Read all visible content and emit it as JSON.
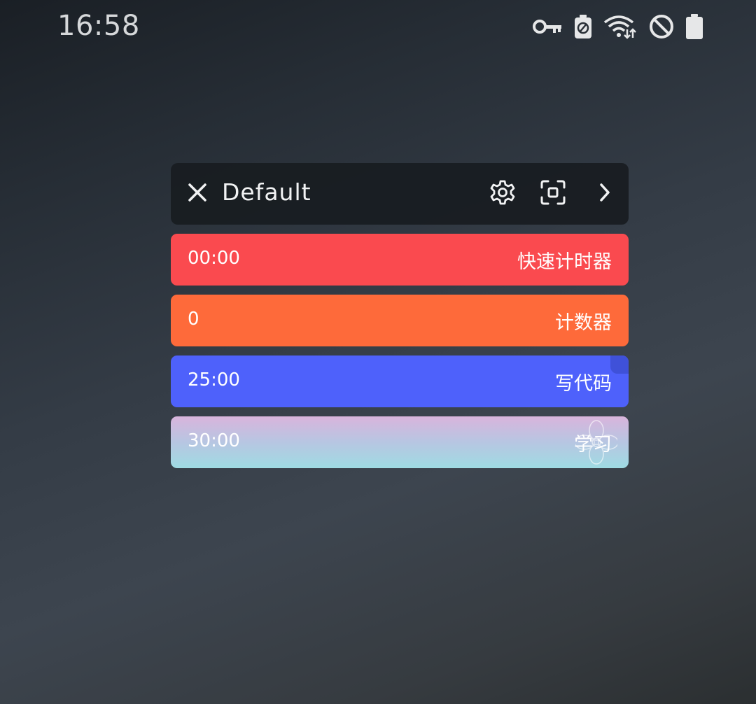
{
  "status_bar": {
    "time": "16:58",
    "icons": [
      "vpn-key-icon",
      "battery-saver-icon",
      "wifi-icon",
      "do-not-disturb-icon",
      "battery-icon"
    ]
  },
  "panel": {
    "title": "Default",
    "header_icons": [
      "close-icon",
      "settings-icon",
      "screenshot-icon",
      "chevron-right-icon"
    ]
  },
  "timers": [
    {
      "value": "00:00",
      "label": "快速计时器",
      "color": "#fa4a4f"
    },
    {
      "value": "0",
      "label": "计数器",
      "color": "#fe6a3a"
    },
    {
      "value": "25:00",
      "label": "写代码",
      "color": "#4e61fb"
    },
    {
      "value": "30:00",
      "label": "学习",
      "color": "gradient #d9b4dc → #9fdbe3"
    }
  ]
}
